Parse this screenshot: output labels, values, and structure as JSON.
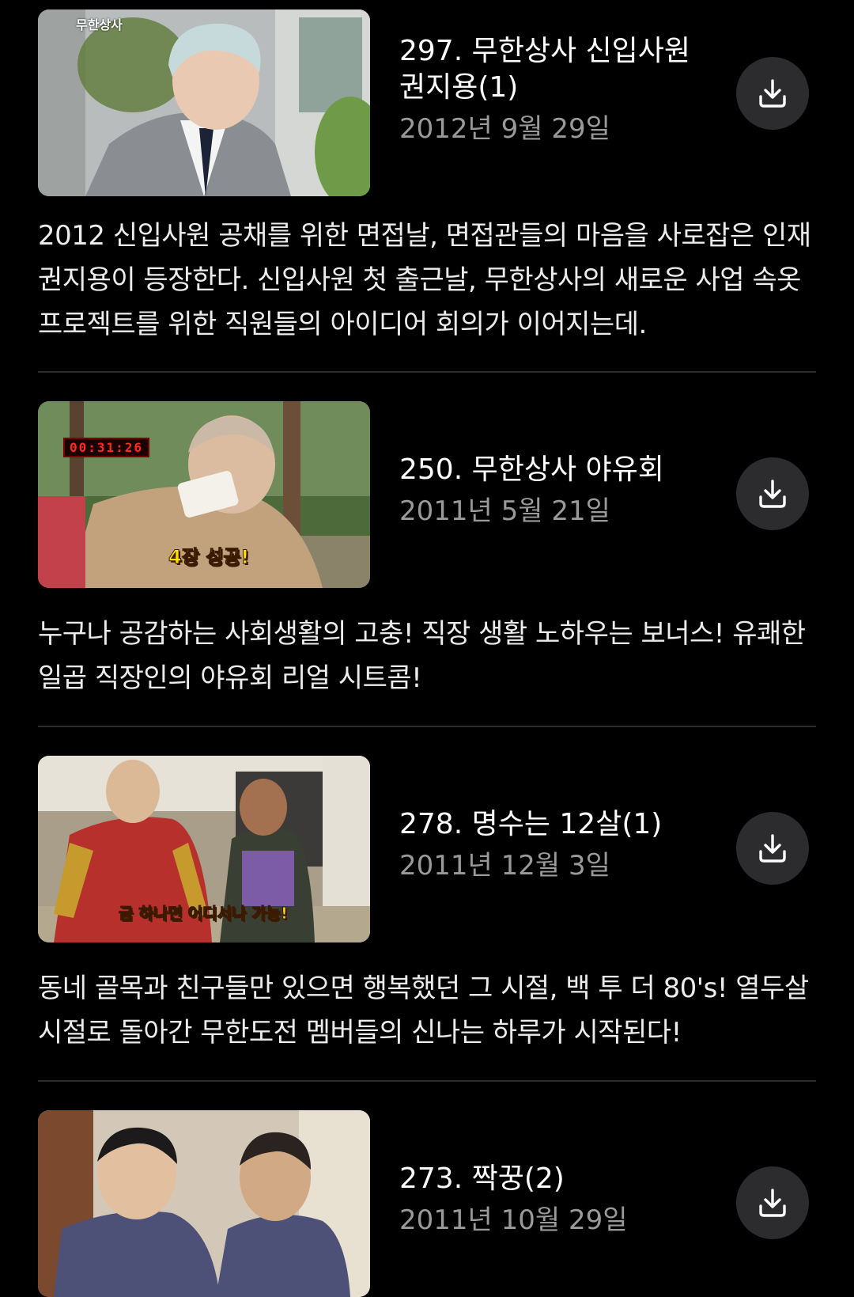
{
  "episodes": [
    {
      "title": "297. 무한상사 신입사원 권지용(1)",
      "date": "2012년 9월 29일",
      "description": "2012 신입사원 공채를 위한 면접날, 면접관들의 마음을 사로잡은 인재 권지용이 등장한다. 신입사원 첫 출근날, 무한상사의 새로운 사업 속옷 프로젝트를 위한 직원들의 아이디어 회의가 이어지는데.",
      "thumb_overlay": "무한상사",
      "thumb_caption": "",
      "download_icon": "download-icon"
    },
    {
      "title": "250. 무한상사 야유회",
      "date": "2011년 5월 21일",
      "description": "누구나 공감하는 사회생활의 고충! 직장 생활 노하우는 보너스! 유쾌한 일곱 직장인의 야유회 리얼 시트콤!",
      "thumb_overlay": "00:31:26",
      "thumb_caption": "4장 성공!",
      "download_icon": "download-icon"
    },
    {
      "title": "278. 명수는 12살(1)",
      "date": "2011년 12월 3일",
      "description": "동네 골목과 친구들만 있으면 행복했던 그 시절, 백 투 더 80's! 열두살 시절로 돌아간 무한도전 멤버들의 신나는 하루가 시작된다!",
      "thumb_overlay": "",
      "thumb_caption": "금 하나면 어디서나 가능!",
      "download_icon": "download-icon"
    },
    {
      "title": "273. 짝꿍(2)",
      "date": "2011년 10월 29일",
      "description": "",
      "thumb_overlay": "",
      "thumb_caption": "",
      "download_icon": "download-icon"
    }
  ],
  "colors": {
    "background": "#000000",
    "title": "#ffffff",
    "date": "#9a9a9a",
    "button": "#2c2c2e",
    "divider": "#2a2a2a"
  }
}
